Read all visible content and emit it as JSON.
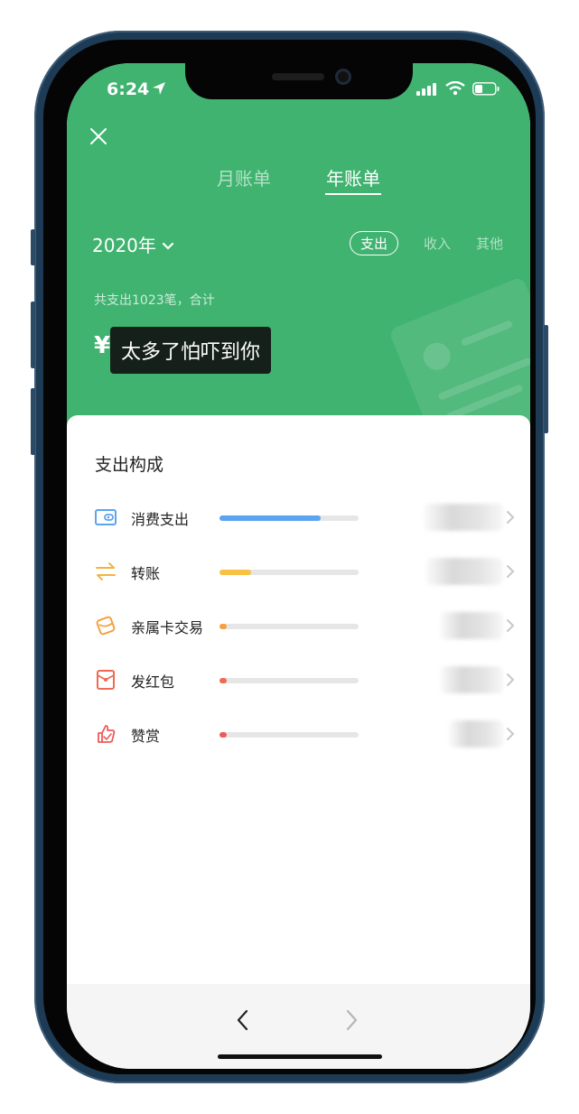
{
  "status": {
    "time": "6:24"
  },
  "tabs": [
    {
      "label": "月账单"
    },
    {
      "label": "年账单"
    }
  ],
  "year_selector": {
    "label": "2020年"
  },
  "filters": [
    {
      "label": "支出"
    },
    {
      "label": "收入"
    },
    {
      "label": "其他"
    }
  ],
  "summary": {
    "text": "共支出1023笔，合计",
    "currency": "¥",
    "overlay": "太多了怕吓到你"
  },
  "breakdown": {
    "title": "支出构成",
    "items": [
      {
        "label": "消费支出",
        "icon": "wallet-icon",
        "share": 0.73,
        "color": "#5ba4f1"
      },
      {
        "label": "转账",
        "icon": "transfer-icon",
        "share": 0.23,
        "color": "#f7c244"
      },
      {
        "label": "亲属卡交易",
        "icon": "family-card-icon",
        "share": 0.04,
        "color": "#f5a03d"
      },
      {
        "label": "发红包",
        "icon": "red-packet-icon",
        "share": 0.04,
        "color": "#ee6a52"
      },
      {
        "label": "赞赏",
        "icon": "appreciate-icon",
        "share": 0.04,
        "color": "#ee5a5a"
      }
    ]
  },
  "colors": {
    "brand_green": "#3fb36f"
  }
}
